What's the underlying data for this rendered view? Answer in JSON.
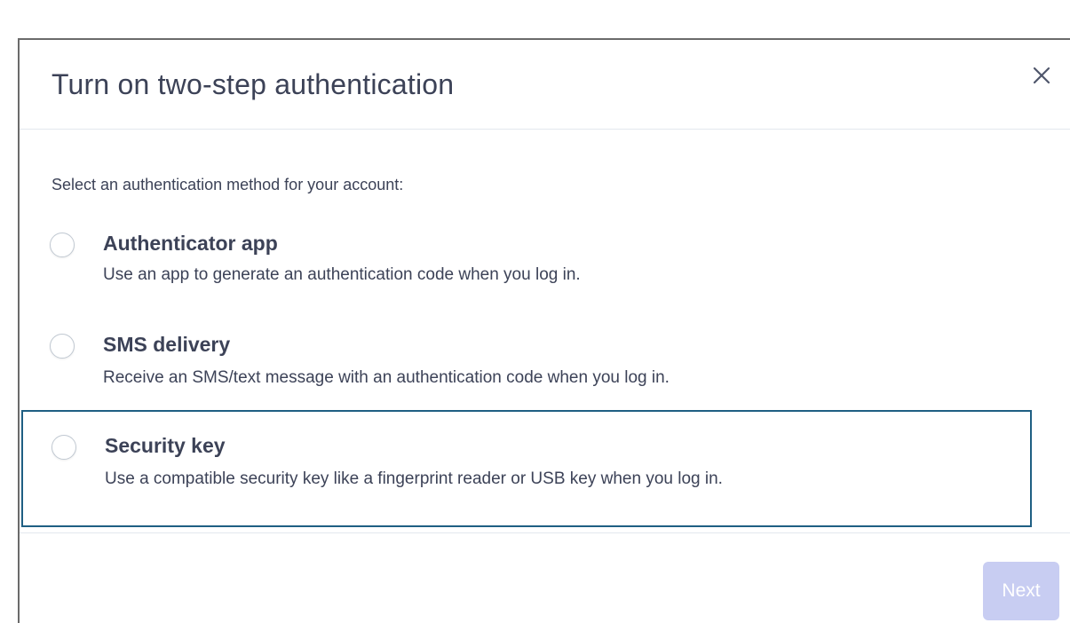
{
  "dialog": {
    "title": "Turn on two-step authentication",
    "close_icon": "close-icon"
  },
  "body": {
    "instruction": "Select an authentication method for your account:",
    "options": [
      {
        "title": "Authenticator app",
        "description": "Use an app to generate an authentication code when you log in.",
        "selected": false
      },
      {
        "title": "SMS delivery",
        "description": "Receive an SMS/text message with an authentication code when you log in.",
        "selected": false
      },
      {
        "title": "Security key",
        "description": "Use a compatible security key like a fingerprint reader or USB key when you log in.",
        "selected": false,
        "focused": true
      }
    ]
  },
  "footer": {
    "next_label": "Next",
    "next_disabled": true
  },
  "colors": {
    "text": "#3c4257",
    "divider": "#e3e8ee",
    "focus_ring": "#1f5f83",
    "next_disabled_bg": "#c8cdf2"
  }
}
